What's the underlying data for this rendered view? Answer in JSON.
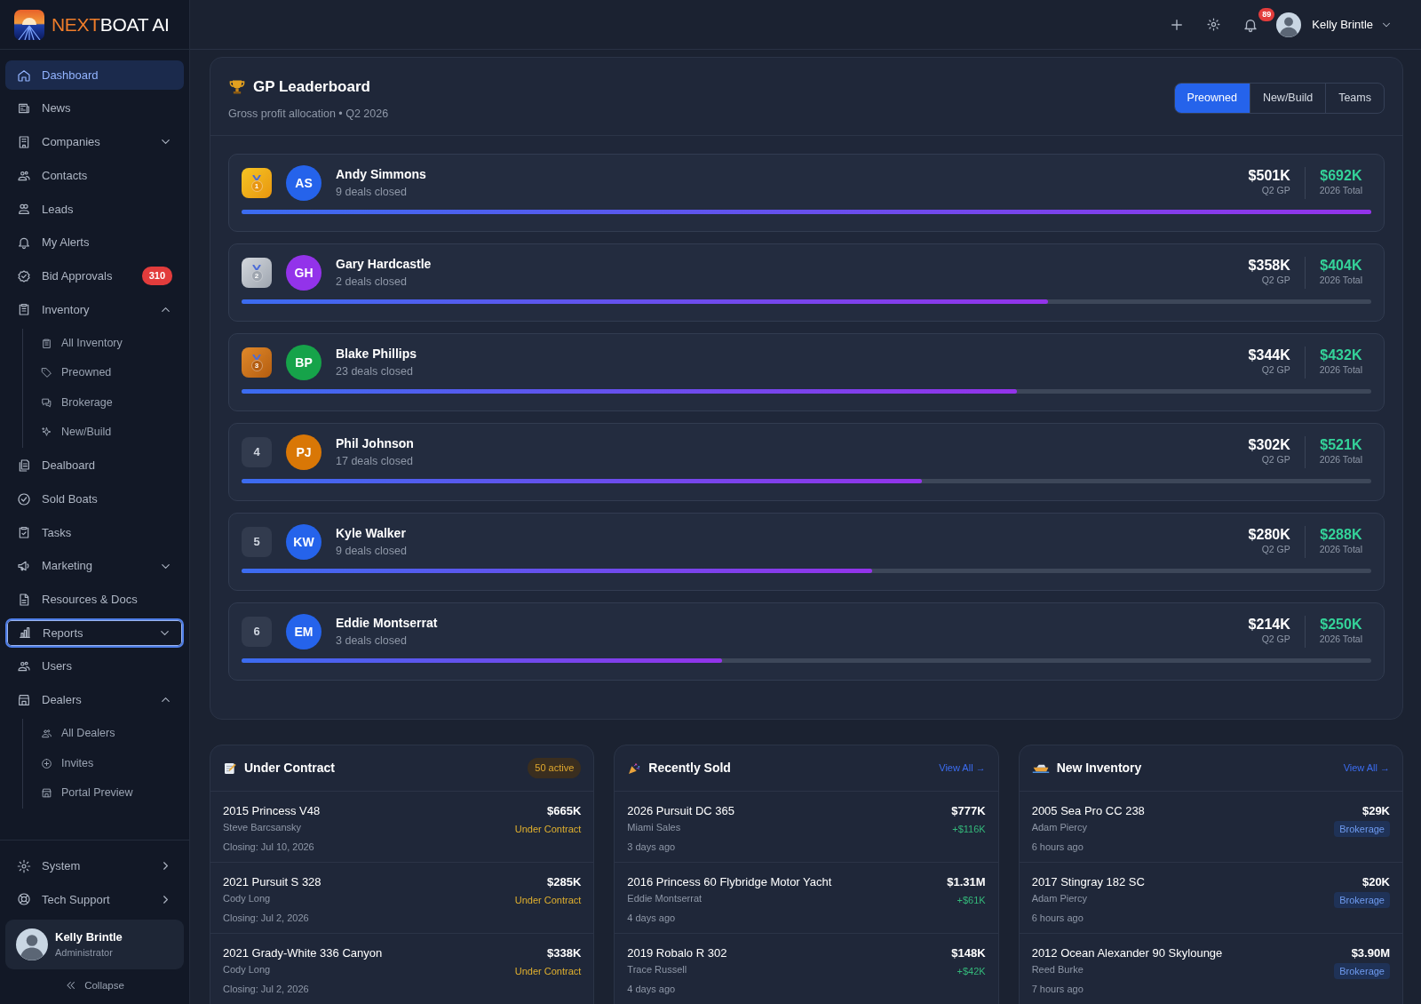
{
  "brand": {
    "accent": "NEXT",
    "rest": "BOAT AI"
  },
  "sidebar": {
    "items": [
      {
        "kind": "link",
        "label": "Dashboard",
        "selected": true,
        "focused": false
      },
      {
        "kind": "link",
        "label": "News",
        "selected": false,
        "focused": false
      },
      {
        "kind": "group",
        "label": "Companies",
        "selected": false,
        "focused": false,
        "expanded": false
      },
      {
        "kind": "link",
        "label": "Contacts",
        "selected": false,
        "focused": false
      },
      {
        "kind": "link",
        "label": "Leads",
        "selected": false,
        "focused": false
      },
      {
        "kind": "link",
        "label": "My Alerts",
        "selected": false,
        "focused": false
      },
      {
        "kind": "link",
        "label": "Bid Approvals",
        "selected": false,
        "focused": false,
        "badge": "310"
      },
      {
        "kind": "group",
        "label": "Inventory",
        "selected": false,
        "focused": false,
        "expanded": true,
        "children": [
          {
            "label": "All Inventory"
          },
          {
            "label": "Preowned"
          },
          {
            "label": "Brokerage"
          },
          {
            "label": "New/Build"
          }
        ]
      },
      {
        "kind": "link",
        "label": "Dealboard",
        "selected": false,
        "focused": false
      },
      {
        "kind": "link",
        "label": "Sold Boats",
        "selected": false,
        "focused": false
      },
      {
        "kind": "link",
        "label": "Tasks",
        "selected": false,
        "focused": false
      },
      {
        "kind": "group",
        "label": "Marketing",
        "selected": false,
        "focused": false,
        "expanded": false
      },
      {
        "kind": "link",
        "label": "Resources & Docs",
        "selected": false,
        "focused": false
      },
      {
        "kind": "group",
        "label": "Reports",
        "selected": false,
        "focused": true,
        "expanded": false
      },
      {
        "kind": "link",
        "label": "Users",
        "selected": false,
        "focused": false
      },
      {
        "kind": "group",
        "label": "Dealers",
        "selected": false,
        "focused": false,
        "expanded": true,
        "children": [
          {
            "label": "All Dealers"
          },
          {
            "label": "Invites"
          },
          {
            "label": "Portal Preview"
          }
        ]
      }
    ],
    "footer_items": [
      {
        "label": "System"
      },
      {
        "label": "Tech Support"
      }
    ],
    "user": {
      "name": "Kelly Brintle",
      "role": "Administrator"
    },
    "collapse": "Collapse"
  },
  "header": {
    "notifications": "89",
    "user": "Kelly Brintle"
  },
  "leaderboard": {
    "title": "GP Leaderboard",
    "subtitle": "Gross profit allocation • Q2 2026",
    "tabs": [
      {
        "label": "Preowned",
        "selected": true
      },
      {
        "label": "New/Build",
        "selected": false
      },
      {
        "label": "Teams",
        "selected": false
      }
    ],
    "rows": [
      {
        "kind": "medal",
        "rank": "1",
        "initials": "AS",
        "color": "#2563eb",
        "name": "Andy Simmons",
        "deals": "9 deals closed",
        "gp": "$501K",
        "gp_label": "Q2 GP",
        "total": "$692K",
        "total_label": "2026 Total",
        "level": 1.0
      },
      {
        "kind": "medal",
        "rank": "2",
        "initials": "GH",
        "color": "#9333ea",
        "name": "Gary Hardcastle",
        "deals": "2 deals closed",
        "gp": "$358K",
        "gp_label": "Q2 GP",
        "total": "$404K",
        "total_label": "2026 Total",
        "level": 0.714
      },
      {
        "kind": "medal",
        "rank": "3",
        "initials": "BP",
        "color": "#16a34a",
        "name": "Blake Phillips",
        "deals": "23 deals closed",
        "gp": "$344K",
        "gp_label": "Q2 GP",
        "total": "$432K",
        "total_label": "2026 Total",
        "level": 0.686
      },
      {
        "kind": "number",
        "rank": "4",
        "initials": "PJ",
        "color": "#d97706",
        "name": "Phil Johnson",
        "deals": "17 deals closed",
        "gp": "$302K",
        "gp_label": "Q2 GP",
        "total": "$521K",
        "total_label": "2026 Total",
        "level": 0.602
      },
      {
        "kind": "number",
        "rank": "5",
        "initials": "KW",
        "color": "#2563eb",
        "name": "Kyle Walker",
        "deals": "9 deals closed",
        "gp": "$280K",
        "gp_label": "Q2 GP",
        "total": "$288K",
        "total_label": "2026 Total",
        "level": 0.558
      },
      {
        "kind": "number",
        "rank": "6",
        "initials": "EM",
        "color": "#2563eb",
        "name": "Eddie Montserrat",
        "deals": "3 deals closed",
        "gp": "$214K",
        "gp_label": "Q2 GP",
        "total": "$250K",
        "total_label": "2026 Total",
        "level": 0.425
      }
    ]
  },
  "panels": [
    {
      "kind": "contract",
      "title": "Under Contract",
      "badge": "50 active",
      "items": [
        {
          "title": "2015 Princess V48",
          "person": "Steve Barcsansky",
          "meta": "Closing: Jul 10, 2026",
          "price": "$665K",
          "note": "Under Contract"
        },
        {
          "title": "2021 Pursuit S 328",
          "person": "Cody Long",
          "meta": "Closing: Jul 2, 2026",
          "price": "$285K",
          "note": "Under Contract"
        },
        {
          "title": "2021 Grady-White 336 Canyon",
          "person": "Cody Long",
          "meta": "Closing: Jul 2, 2026",
          "price": "$338K",
          "note": "Under Contract"
        }
      ]
    },
    {
      "kind": "sold",
      "title": "Recently Sold",
      "link": "View All →",
      "items": [
        {
          "title": "2026 Pursuit DC 365",
          "person": "Miami Sales",
          "meta": "3 days ago",
          "price": "$777K",
          "note": "+$116K"
        },
        {
          "title": "2016 Princess 60 Flybridge Motor Yacht",
          "person": "Eddie Montserrat",
          "meta": "4 days ago",
          "price": "$1.31M",
          "note": "+$61K"
        },
        {
          "title": "2019 Robalo R 302",
          "person": "Trace Russell",
          "meta": "4 days ago",
          "price": "$148K",
          "note": "+$42K"
        }
      ]
    },
    {
      "kind": "inventory",
      "title": "New Inventory",
      "link": "View All →",
      "items": [
        {
          "title": "2005 Sea Pro CC 238",
          "person": "Adam Piercy",
          "meta": "6 hours ago",
          "price": "$29K",
          "note": "Brokerage"
        },
        {
          "title": "2017 Stingray 182 SC",
          "person": "Adam Piercy",
          "meta": "6 hours ago",
          "price": "$20K",
          "note": "Brokerage"
        },
        {
          "title": "2012 Ocean Alexander 90 Skylounge",
          "person": "Reed Burke",
          "meta": "7 hours ago",
          "price": "$3.90M",
          "note": "Brokerage"
        }
      ]
    }
  ]
}
